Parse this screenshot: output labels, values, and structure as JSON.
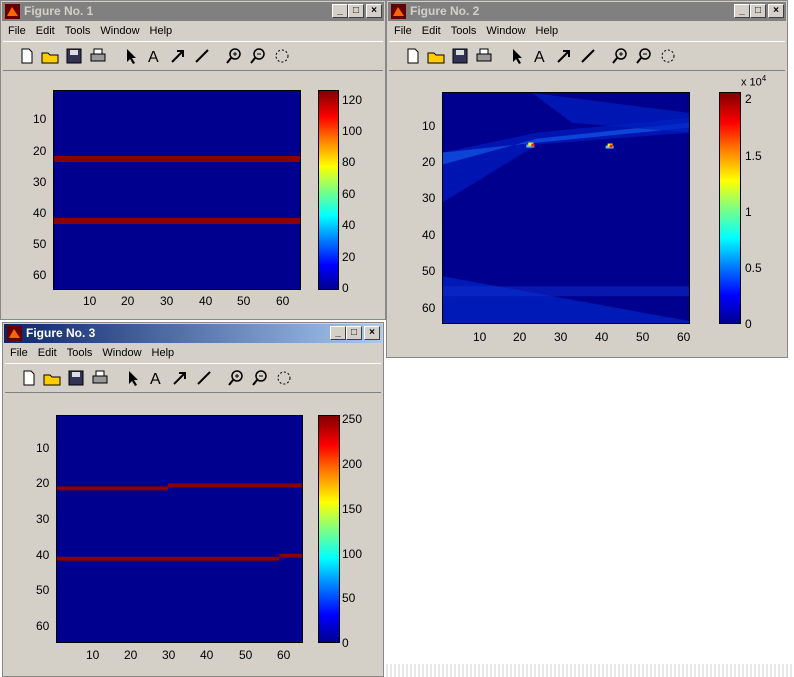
{
  "windows": [
    {
      "title": "Figure No. 1",
      "menu": [
        "File",
        "Edit",
        "Tools",
        "Window",
        "Help"
      ],
      "yticks": [
        "10",
        "20",
        "30",
        "40",
        "50",
        "60"
      ],
      "xticks": [
        "10",
        "20",
        "30",
        "40",
        "50",
        "60"
      ],
      "cbar_ticks": [
        "120",
        "100",
        "80",
        "60",
        "40",
        "20",
        "0"
      ]
    },
    {
      "title": "Figure No. 2",
      "menu": [
        "File",
        "Edit",
        "Tools",
        "Window",
        "Help"
      ],
      "yticks": [
        "10",
        "20",
        "30",
        "40",
        "50",
        "60"
      ],
      "xticks": [
        "10",
        "20",
        "30",
        "40",
        "50",
        "60"
      ],
      "cbar_ticks": [
        "2",
        "1.5",
        "1",
        "0.5",
        "0"
      ],
      "cbar_exponent": "x 10",
      "cbar_exponent_power": "4"
    },
    {
      "title": "Figure No. 3",
      "menu": [
        "File",
        "Edit",
        "Tools",
        "Window",
        "Help"
      ],
      "yticks": [
        "10",
        "20",
        "30",
        "40",
        "50",
        "60"
      ],
      "xticks": [
        "10",
        "20",
        "30",
        "40",
        "50",
        "60"
      ],
      "cbar_ticks": [
        "250",
        "200",
        "150",
        "100",
        "50",
        "0"
      ]
    }
  ],
  "title_buttons": {
    "minimize": "_",
    "maximize": "□",
    "close": "×"
  },
  "colors": {
    "background": "#00008f",
    "line": "#8b0000"
  }
}
